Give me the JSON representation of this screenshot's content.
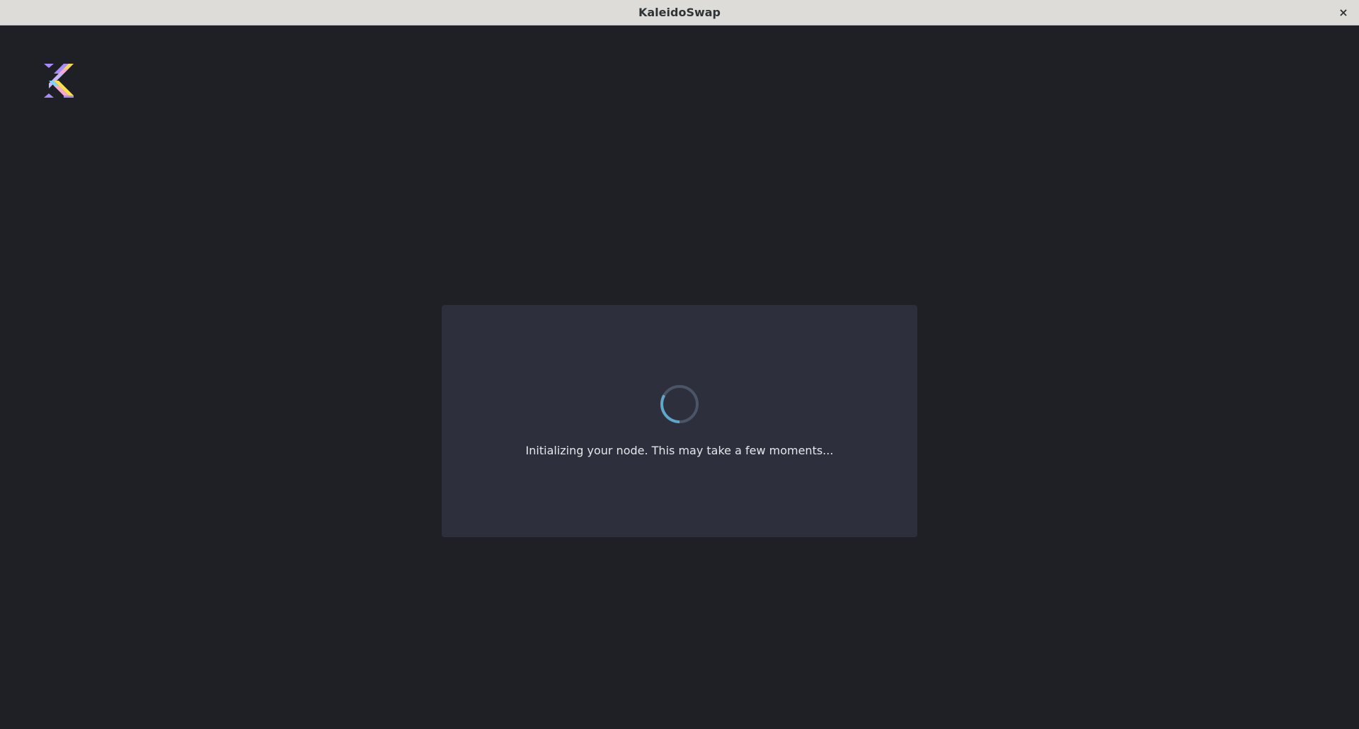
{
  "window": {
    "title": "KaleidoSwap",
    "close_label": "×"
  },
  "logo": {
    "icon": "kaleidoswap-logo",
    "colors": [
      "#a78bfa",
      "#f9a8d4",
      "#fde047",
      "#7dd3fc",
      "#c4b5fd"
    ]
  },
  "loading": {
    "message": "Initializing your node. This may take a few moments...",
    "spinner_color": "#5fa6c9",
    "spinner_track": "#4a5568"
  },
  "colors": {
    "background": "#1f2025",
    "card": "#2d2f3c",
    "titlebar": "#dedcd9"
  }
}
